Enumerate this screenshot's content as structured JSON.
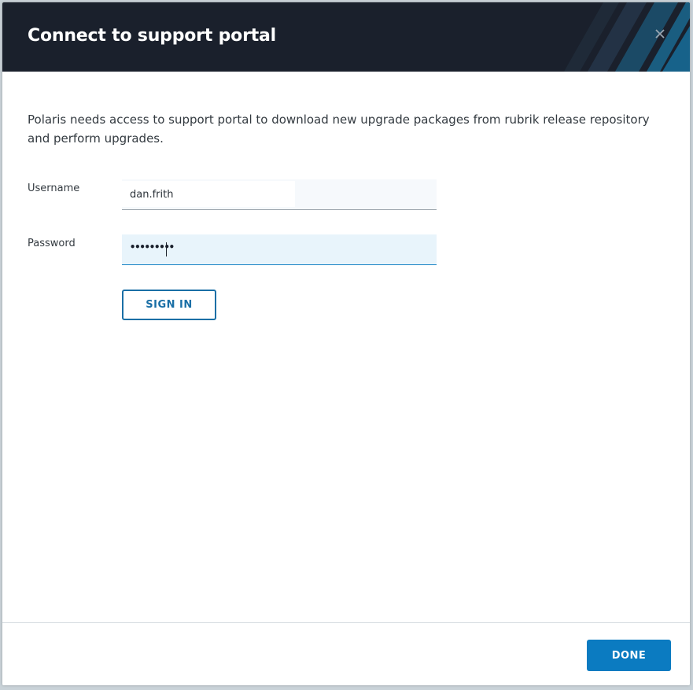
{
  "dialog": {
    "title": "Connect to support portal",
    "close_icon": "close-icon",
    "description": "Polaris needs access to support portal to download new upgrade packages from rubrik release repository and perform upgrades.",
    "username": {
      "label": "Username",
      "value": "dan.frith"
    },
    "password": {
      "label": "Password",
      "masked_value": "•••••••••"
    },
    "sign_in_label": "SIGN IN",
    "done_label": "DONE"
  },
  "colors": {
    "header_bg": "#1a202c",
    "accent": "#0b7bc1",
    "input_focus_bg": "#e8f4fb"
  }
}
